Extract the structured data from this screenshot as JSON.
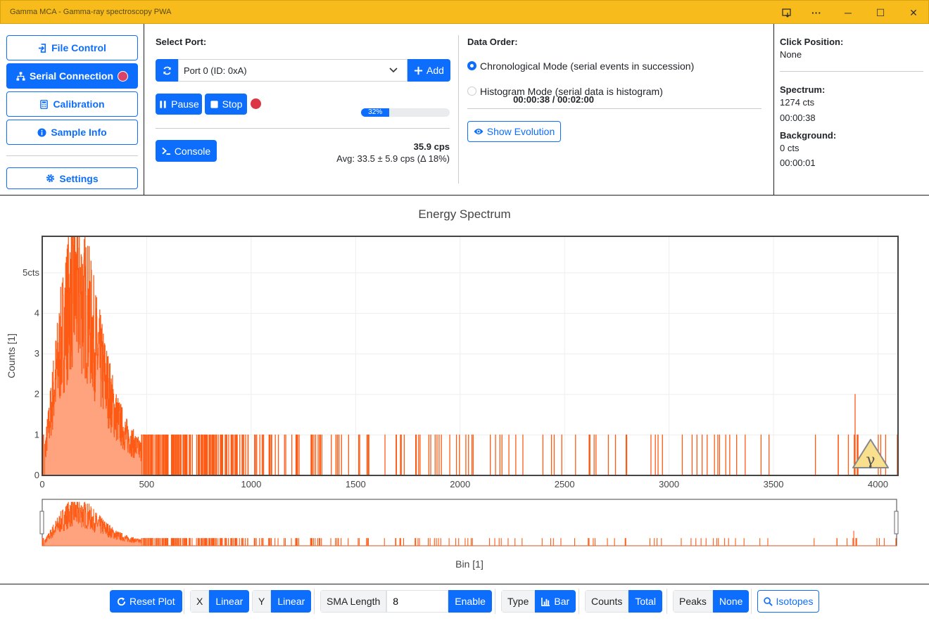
{
  "window": {
    "title": "Gamma MCA - Gamma-ray spectroscopy PWA"
  },
  "nav": {
    "file_control": "File Control",
    "serial_connection": "Serial Connection",
    "calibration": "Calibration",
    "sample_info": "Sample Info",
    "settings": "Settings"
  },
  "serial": {
    "select_port_label": "Select Port:",
    "port_value": "Port 0 (ID: 0xA)",
    "add_label": "Add",
    "pause_label": "Pause",
    "stop_label": "Stop",
    "time_readout": "00:00:38 / 00:02:00",
    "progress_label": "32%",
    "progress_percent": 32,
    "console_label": "Console",
    "cps": "35.9 cps",
    "avg": "Avg: 33.5 ± 5.9 cps (Δ 18%)"
  },
  "data_order": {
    "label": "Data Order:",
    "chronological": "Chronological Mode (serial events in succession)",
    "histogram": "Histogram Mode (serial data is histogram)",
    "selected": "chronological",
    "show_evolution": "Show Evolution"
  },
  "info": {
    "click_position_label": "Click Position:",
    "click_position_value": "None",
    "spectrum_label": "Spectrum:",
    "spectrum_counts": "1274 cts",
    "spectrum_time": "00:00:38",
    "background_label": "Background:",
    "background_counts": "0 cts",
    "background_time": "00:00:01"
  },
  "chart_data": {
    "type": "bar",
    "title": "Energy Spectrum",
    "xlabel": "Bin [1]",
    "ylabel": "Counts [1]",
    "xlim": [
      0,
      4096
    ],
    "ylim": [
      0,
      5.9
    ],
    "x_ticks": [
      0,
      500,
      1000,
      1500,
      2000,
      2500,
      3000,
      3500,
      4000
    ],
    "y_ticks": [
      0,
      1,
      2,
      3,
      4,
      5
    ],
    "y_tick_labels": [
      "0",
      "1",
      "2",
      "3",
      "4",
      "5cts"
    ],
    "grid": true,
    "series_color": "#ff5a14",
    "fill_color": "#ffa27e",
    "envelope": {
      "bins": [
        0,
        30,
        60,
        100,
        140,
        180,
        220,
        260,
        300,
        350,
        400,
        450,
        500,
        600,
        700,
        800,
        1000,
        1300,
        1700,
        2500,
        4096
      ],
      "mean_counts": [
        0.2,
        1.2,
        2.3,
        3.6,
        4.6,
        4.5,
        4.0,
        3.1,
        2.4,
        1.5,
        1.0,
        0.7,
        0.5,
        0.35,
        0.25,
        0.18,
        0.1,
        0.06,
        0.04,
        0.02,
        0.015
      ]
    },
    "spikes": [
      [
        1220,
        1
      ],
      [
        1420,
        1
      ],
      [
        1640,
        1
      ],
      [
        1880,
        1
      ],
      [
        1950,
        1
      ],
      [
        2040,
        1
      ],
      [
        2200,
        1
      ],
      [
        2300,
        1
      ],
      [
        2650,
        1
      ],
      [
        3110,
        1
      ],
      [
        3810,
        1
      ],
      [
        3890,
        2
      ]
    ]
  },
  "toolbar": {
    "reset_plot": "Reset Plot",
    "x_label": "X",
    "x_value": "Linear",
    "y_label": "Y",
    "y_value": "Linear",
    "sma_label": "SMA Length",
    "sma_value": "8",
    "enable_label": "Enable",
    "type_label": "Type",
    "type_value": "Bar",
    "counts_label": "Counts",
    "counts_value": "Total",
    "peaks_label": "Peaks",
    "peaks_value": "None",
    "isotopes_label": "Isotopes"
  },
  "colors": {
    "accent": "#0d6efd",
    "titlebar": "#f7bc1b",
    "record_dot": "#dc3545"
  }
}
